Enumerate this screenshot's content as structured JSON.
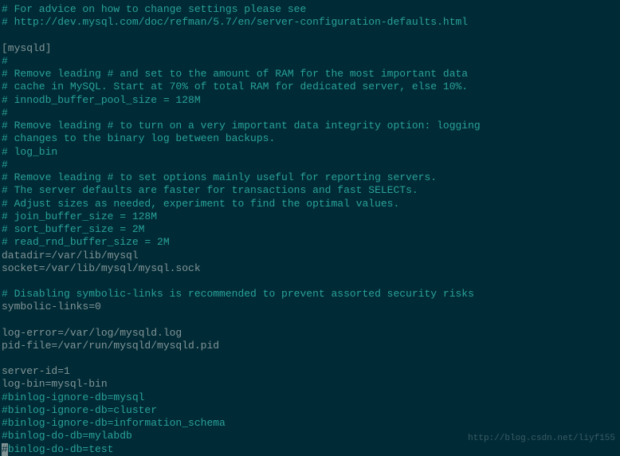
{
  "lines": [
    {
      "cls": "comment",
      "text": "# For advice on how to change settings please see"
    },
    {
      "cls": "comment",
      "text": "# http://dev.mysql.com/doc/refman/5.7/en/server-configuration-defaults.html"
    },
    {
      "cls": "plain",
      "text": ""
    },
    {
      "cls": "plain",
      "text": "[mysqld]"
    },
    {
      "cls": "comment",
      "text": "#"
    },
    {
      "cls": "comment",
      "text": "# Remove leading # and set to the amount of RAM for the most important data"
    },
    {
      "cls": "comment",
      "text": "# cache in MySQL. Start at 70% of total RAM for dedicated server, else 10%."
    },
    {
      "cls": "comment",
      "text": "# innodb_buffer_pool_size = 128M"
    },
    {
      "cls": "comment",
      "text": "#"
    },
    {
      "cls": "comment",
      "text": "# Remove leading # to turn on a very important data integrity option: logging"
    },
    {
      "cls": "comment",
      "text": "# changes to the binary log between backups."
    },
    {
      "cls": "comment",
      "text": "# log_bin"
    },
    {
      "cls": "comment",
      "text": "#"
    },
    {
      "cls": "comment",
      "text": "# Remove leading # to set options mainly useful for reporting servers."
    },
    {
      "cls": "comment",
      "text": "# The server defaults are faster for transactions and fast SELECTs."
    },
    {
      "cls": "comment",
      "text": "# Adjust sizes as needed, experiment to find the optimal values."
    },
    {
      "cls": "comment",
      "text": "# join_buffer_size = 128M"
    },
    {
      "cls": "comment",
      "text": "# sort_buffer_size = 2M"
    },
    {
      "cls": "comment",
      "text": "# read_rnd_buffer_size = 2M"
    },
    {
      "cls": "plain",
      "text": "datadir=/var/lib/mysql"
    },
    {
      "cls": "plain",
      "text": "socket=/var/lib/mysql/mysql.sock"
    },
    {
      "cls": "plain",
      "text": ""
    },
    {
      "cls": "comment",
      "text": "# Disabling symbolic-links is recommended to prevent assorted security risks"
    },
    {
      "cls": "plain",
      "text": "symbolic-links=0"
    },
    {
      "cls": "plain",
      "text": ""
    },
    {
      "cls": "plain",
      "text": "log-error=/var/log/mysqld.log"
    },
    {
      "cls": "plain",
      "text": "pid-file=/var/run/mysqld/mysqld.pid"
    },
    {
      "cls": "plain",
      "text": ""
    },
    {
      "cls": "plain",
      "text": "server-id=1"
    },
    {
      "cls": "plain",
      "text": "log-bin=mysql-bin"
    },
    {
      "cls": "comment",
      "text": "#binlog-ignore-db=mysql"
    },
    {
      "cls": "comment",
      "text": "#binlog-ignore-db=cluster"
    },
    {
      "cls": "comment",
      "text": "#binlog-ignore-db=information_schema"
    },
    {
      "cls": "comment",
      "text": "#binlog-do-db=mylabdb"
    }
  ],
  "cursor_line": {
    "cursor_char": "#",
    "rest": "binlog-do-db=test"
  },
  "watermark": "http://blog.csdn.net/liyf155"
}
